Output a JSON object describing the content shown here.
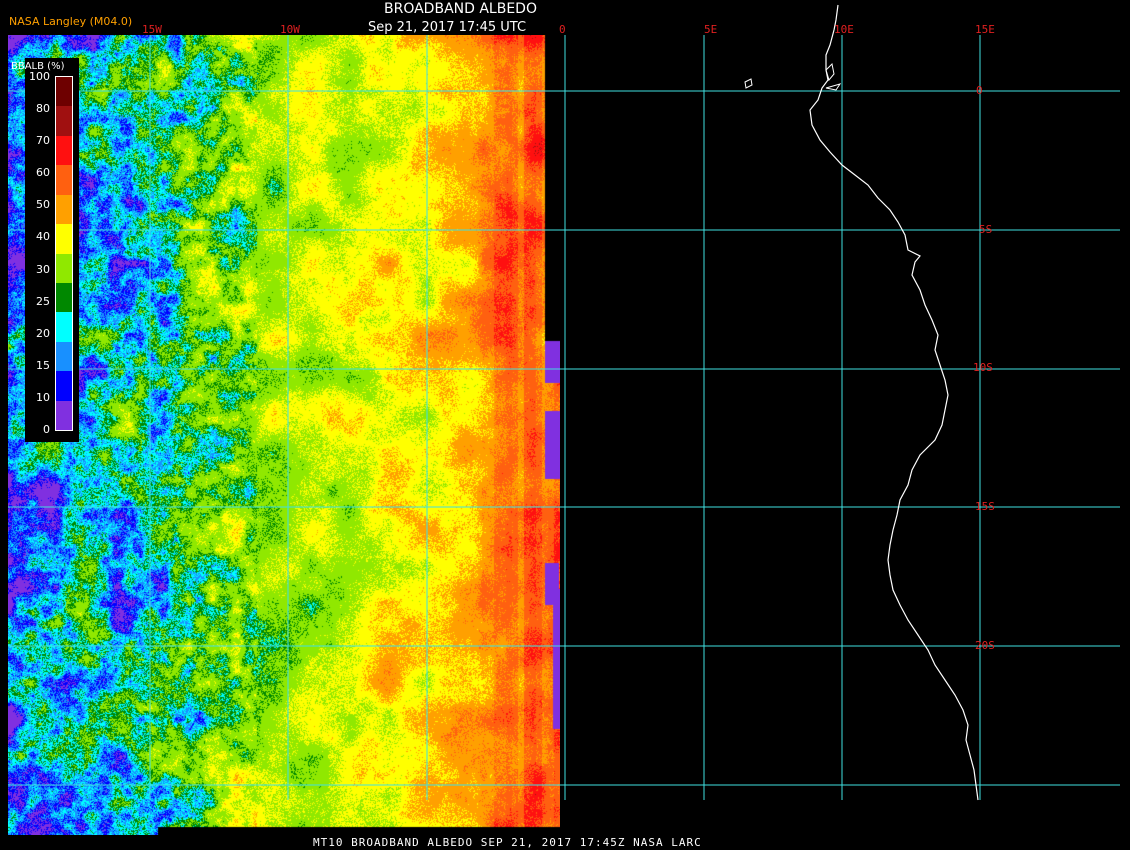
{
  "header": {
    "title": "BROADBAND ALBEDO",
    "datetime": "Sep 21, 2017 17:45 UTC",
    "credit": "NASA Langley (M04.0)"
  },
  "footer": {
    "caption": "MT10  BROADBAND ALBEDO   SEP 21, 2017 17:45Z   NASA LARC"
  },
  "legend": {
    "title": "BBALB (%)",
    "ticks": [
      "100",
      "80",
      "70",
      "60",
      "50",
      "40",
      "30",
      "25",
      "20",
      "15",
      "10",
      "0"
    ],
    "bins": [
      {
        "max": 100,
        "color": "#6e0000"
      },
      {
        "max": 90,
        "color": "#a01010"
      },
      {
        "max": 80,
        "color": "#ff1010"
      },
      {
        "max": 70,
        "color": "#ff6010"
      },
      {
        "max": 60,
        "color": "#ffa000"
      },
      {
        "max": 50,
        "color": "#ffff00"
      },
      {
        "max": 40,
        "color": "#90e800"
      },
      {
        "max": 30,
        "color": "#008800"
      },
      {
        "max": 25,
        "color": "#00ffff"
      },
      {
        "max": 20,
        "color": "#1890ff"
      },
      {
        "max": 15,
        "color": "#0000ff"
      },
      {
        "max": 10,
        "color": "#8030e0"
      }
    ]
  },
  "grid": {
    "longitudes": [
      "15W",
      "10W",
      "0",
      "5E",
      "10E",
      "15E"
    ],
    "latitudes": [
      "0",
      "5S",
      "10S",
      "15S",
      "20S"
    ],
    "line_color": "#40e0e0",
    "coast_color": "#ffffff"
  }
}
